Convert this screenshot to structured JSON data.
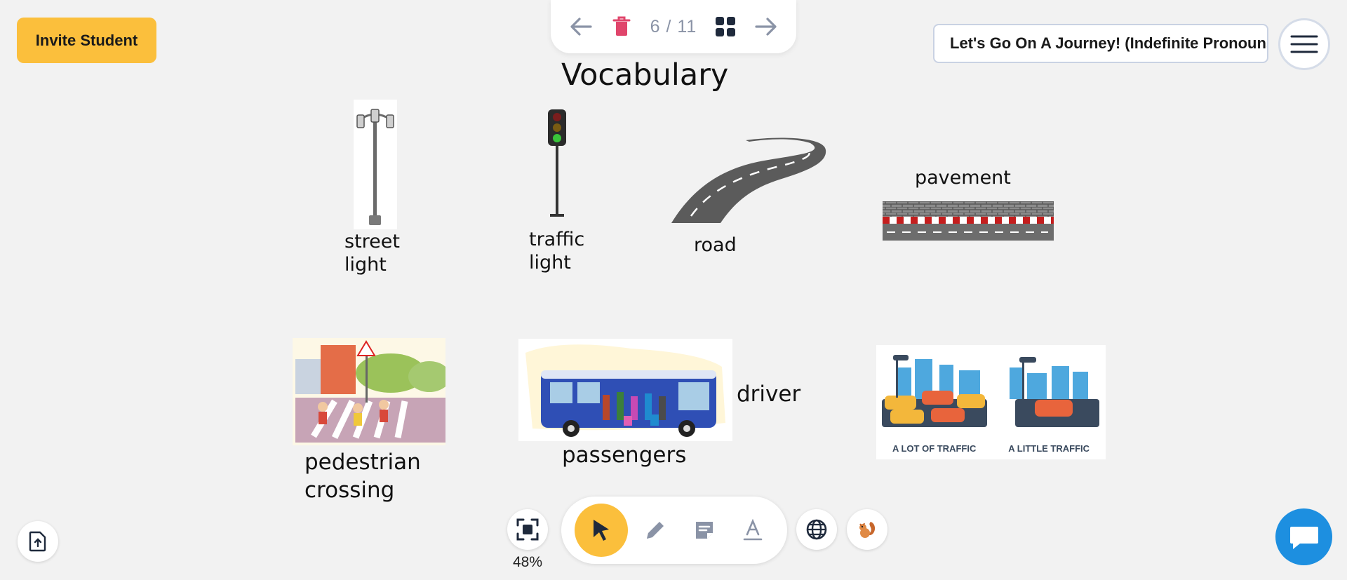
{
  "header": {
    "invite_label": "Invite Student",
    "page_counter": "6 / 11",
    "lesson_title": "Let's Go On A Journey! (Indefinite Pronouns)"
  },
  "slide": {
    "heading": "Vocabulary",
    "items": {
      "street_light": "street light",
      "traffic_light": "traffic light",
      "road": "road",
      "pavement": "pavement",
      "pedestrian_crossing": "pedestrian crossing",
      "passengers": "passengers",
      "driver": "driver",
      "a_lot_of_traffic": "A LOT OF TRAFFIC",
      "a_little_traffic": "A LITTLE TRAFFIC"
    }
  },
  "toolbar": {
    "zoom": "48%",
    "tools": [
      "select",
      "pen",
      "sticky-note",
      "text"
    ]
  },
  "colors": {
    "accent": "#fbbf3c",
    "delete": "#e0456b",
    "icon_gray": "#8a93a6",
    "chat": "#1d8fe0"
  },
  "icons": [
    "arrow-left-icon",
    "trash-icon",
    "grid-icon",
    "arrow-right-icon",
    "hamburger-icon",
    "upload-file-icon",
    "focus-icon",
    "cursor-icon",
    "pencil-icon",
    "note-icon",
    "text-icon",
    "globe-icon",
    "squirrel-icon",
    "chat-icon"
  ]
}
